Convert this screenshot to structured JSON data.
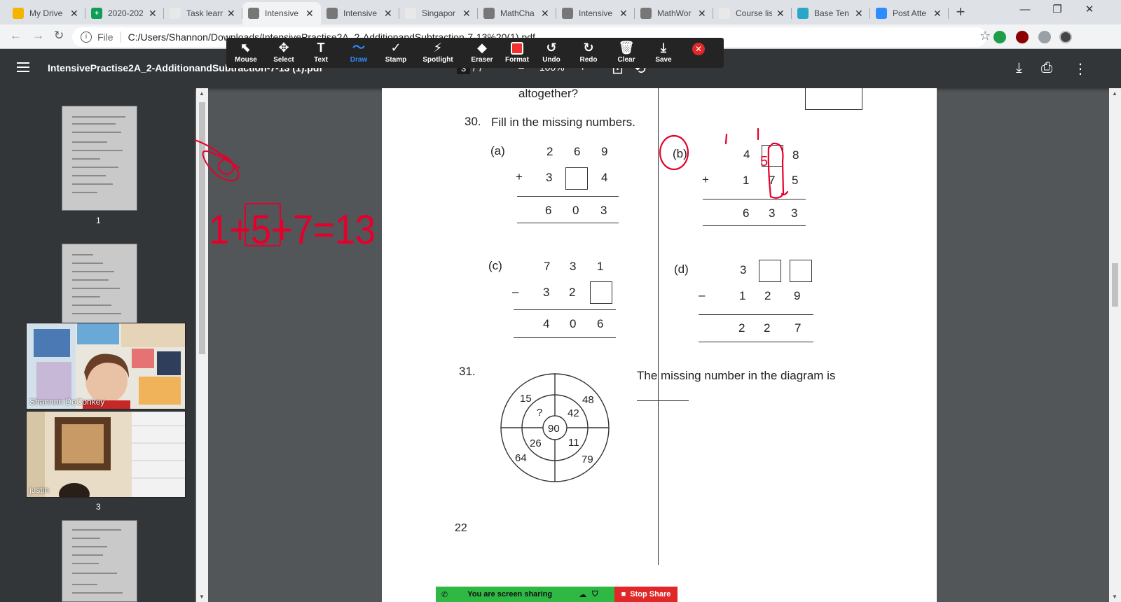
{
  "tabs": [
    {
      "label": "My Drive",
      "favicon_color": "#f4b400",
      "favicon_glyph": "",
      "active": false
    },
    {
      "label": "2020-202",
      "favicon_color": "#0f9d58",
      "favicon_glyph": "+",
      "active": false
    },
    {
      "label": "Task learn",
      "favicon_color": "#e8e8e8",
      "favicon_glyph": "",
      "active": false
    },
    {
      "label": "Intensive",
      "favicon_color": "#777777",
      "favicon_glyph": "",
      "active": true
    },
    {
      "label": "Intensive",
      "favicon_color": "#777777",
      "favicon_glyph": "",
      "active": false
    },
    {
      "label": "Singapor",
      "favicon_color": "#e8e8e8",
      "favicon_glyph": "",
      "active": false
    },
    {
      "label": "MathCha",
      "favicon_color": "#777777",
      "favicon_glyph": "",
      "active": false
    },
    {
      "label": "Intensive",
      "favicon_color": "#777777",
      "favicon_glyph": "",
      "active": false
    },
    {
      "label": "MathWor",
      "favicon_color": "#777777",
      "favicon_glyph": "",
      "active": false
    },
    {
      "label": "Course lis",
      "favicon_color": "#e8e8e8",
      "favicon_glyph": "",
      "active": false
    },
    {
      "label": "Base Ten",
      "favicon_color": "#2aa6c8",
      "favicon_glyph": "",
      "active": false
    },
    {
      "label": "Post Atte",
      "favicon_color": "#2d8cff",
      "favicon_glyph": "",
      "active": false
    }
  ],
  "address_bar": {
    "scheme_label": "File",
    "url": "C:/Users/Shannon/Downloads/IntensivePractise2A_2-AdditionandSubtraction-7-13%20(1).pdf"
  },
  "pdf_viewer": {
    "title": "IntensivePractise2A_2-AdditionandSubtraction-7-13 (1).pdf",
    "current_page": "3",
    "page_sep": "/",
    "total_pages": "7",
    "zoom_minus": "–",
    "zoom": "100%",
    "zoom_plus": "+"
  },
  "annotation_toolbar": {
    "buttons": [
      {
        "label": "Mouse",
        "icon": "cursor-icon",
        "glyph": "⬉"
      },
      {
        "label": "Select",
        "icon": "move-icon",
        "glyph": "✥"
      },
      {
        "label": "Text",
        "icon": "text-icon",
        "glyph": "T"
      },
      {
        "label": "Draw",
        "icon": "draw-icon",
        "glyph": "〜"
      },
      {
        "label": "Stamp",
        "icon": "stamp-icon",
        "glyph": "✓"
      },
      {
        "label": "Spotlight",
        "icon": "spotlight-icon",
        "glyph": "⚡"
      },
      {
        "label": "Eraser",
        "icon": "eraser-icon",
        "glyph": "◆"
      },
      {
        "label": "Format",
        "icon": "format-icon",
        "glyph": ""
      },
      {
        "label": "Undo",
        "icon": "undo-icon",
        "glyph": "↺"
      },
      {
        "label": "Redo",
        "icon": "redo-icon",
        "glyph": "↻"
      },
      {
        "label": "Clear",
        "icon": "trash-icon",
        "glyph": "🗑"
      },
      {
        "label": "Save",
        "icon": "save-icon",
        "glyph": "⤓"
      }
    ],
    "active_tool": "Draw",
    "format_color": "#f23030"
  },
  "sidebar": {
    "thumb_numbers": [
      "1",
      "3"
    ]
  },
  "participants": [
    {
      "name": "Shannon DeConkey"
    },
    {
      "name": "justin"
    }
  ],
  "document": {
    "prev_line": "altogether?",
    "q30_number": "30.",
    "q30_text": "Fill in the missing numbers.",
    "a": {
      "label": "(a)",
      "row1": [
        "2",
        "6",
        "9"
      ],
      "op": "+",
      "row2": [
        "3",
        "",
        "4"
      ],
      "result": [
        "6",
        "0",
        "3"
      ]
    },
    "b": {
      "label": "(b)",
      "row1": [
        "4",
        "",
        "8"
      ],
      "op": "+",
      "row2": [
        "1",
        "7",
        "5"
      ],
      "result": [
        "6",
        "3",
        "3"
      ],
      "carry": [
        "1",
        "1"
      ],
      "answer": "5"
    },
    "c": {
      "label": "(c)",
      "row1": [
        "7",
        "3",
        "1"
      ],
      "op": "–",
      "row2": [
        "3",
        "2",
        ""
      ],
      "result": [
        "4",
        "0",
        "6"
      ]
    },
    "d": {
      "label": "(d)",
      "row1": [
        "3",
        "",
        ""
      ],
      "op": "–",
      "row2": [
        "1",
        "2",
        "9"
      ],
      "result": [
        "2",
        "2",
        "7"
      ]
    },
    "q31_number": "31.",
    "q31_text": "The missing number in the diagram is",
    "diagram": {
      "outer": [
        "15",
        "48",
        "64",
        "79"
      ],
      "middle": [
        "?",
        "42",
        "26",
        "11"
      ],
      "center": "90"
    },
    "page_number": "22"
  },
  "annotation_overlay": {
    "equation": "1+5+7=13",
    "color": "#e4002b"
  },
  "share_bar": {
    "status": "You are screen sharing",
    "stop_label": "Stop Share"
  }
}
